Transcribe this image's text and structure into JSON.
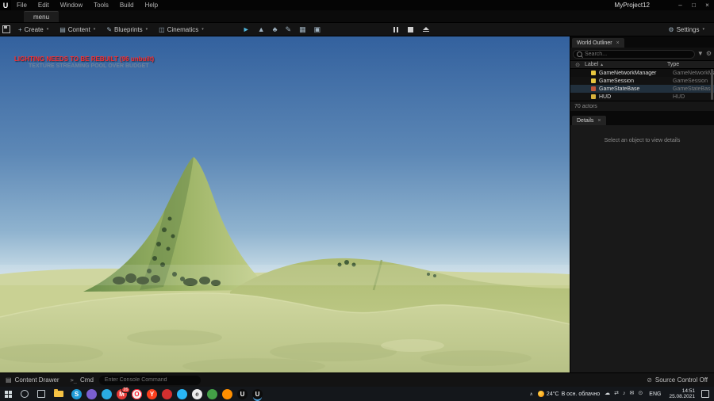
{
  "window": {
    "logo_glyph": "U",
    "menus": [
      "File",
      "Edit",
      "Window",
      "Tools",
      "Build",
      "Help"
    ],
    "project": "MyProject12",
    "controls": {
      "min": "–",
      "max": "□",
      "close": "×"
    }
  },
  "tabs": {
    "level_tab": "menu"
  },
  "toolbar": {
    "buttons": [
      {
        "label": "Create",
        "glyph": "+"
      },
      {
        "label": "Content",
        "glyph": "▤"
      },
      {
        "label": "Blueprints",
        "glyph": "✎"
      },
      {
        "label": "Cinematics",
        "glyph": "◫"
      }
    ],
    "modes": [
      {
        "name": "select-mode-icon",
        "glyph": "►",
        "color": "#4fb3d9"
      },
      {
        "name": "landscape-mode-icon",
        "glyph": "▲",
        "color": "#9fb2c0"
      },
      {
        "name": "foliage-mode-icon",
        "glyph": "♣",
        "color": "#9fb2c0"
      },
      {
        "name": "paint-mode-icon",
        "glyph": "✎",
        "color": "#9fb2c0"
      },
      {
        "name": "fracture-mode-icon",
        "glyph": "▦",
        "color": "#9fb2c0"
      },
      {
        "name": "brush-mode-icon",
        "glyph": "▣",
        "color": "#9fb2c0"
      }
    ],
    "settings_label": "Settings"
  },
  "viewport": {
    "warning_line1": "LIGHTING NEEDS TO BE REBUILT (96 unbuilt)",
    "warning_line2": "TEXTURE STREAMING POOL OVER BUDGET"
  },
  "outliner": {
    "title": "World Outliner",
    "search_placeholder": "Search...",
    "col_label": "Label",
    "col_type": "Type",
    "sort_arrow": "▲",
    "rows": [
      {
        "label": "GameNetworkManager",
        "type": "GameNetworkManager",
        "icon_color": "#e7c63f"
      },
      {
        "label": "GameSession",
        "type": "GameSession",
        "icon_color": "#e7c63f"
      },
      {
        "label": "GameStateBase",
        "type": "GameStateBase",
        "icon_color": "#c0543a"
      },
      {
        "label": "HUD",
        "type": "HUD",
        "icon_color": "#d8b13c"
      }
    ],
    "footer": "70 actors"
  },
  "details": {
    "title": "Details",
    "empty_text": "Select an object to view details"
  },
  "statusbar": {
    "content_drawer": "Content Drawer",
    "cmd": "Cmd",
    "console_placeholder": "Enter Console Command",
    "source_control": "Source Control Off"
  },
  "taskbar": {
    "apps": [
      {
        "name": "taskbar-app-blue-messenger",
        "bg": "#1f9bd7",
        "glyph": "S"
      },
      {
        "name": "taskbar-app-purple",
        "bg": "#7a5fd0",
        "glyph": ""
      },
      {
        "name": "taskbar-app-blue",
        "bg": "#2aabe2",
        "glyph": ""
      },
      {
        "name": "taskbar-app-mail",
        "bg": "#e53935",
        "glyph": "M",
        "badge": "26"
      },
      {
        "name": "taskbar-app-opera",
        "bg": "#f2f2f2",
        "fg": "#ff1b2d",
        "glyph": "O",
        "ring": "#ff1b2d"
      },
      {
        "name": "taskbar-app-yandex",
        "bg": "#fc3f1d",
        "glyph": "Y"
      },
      {
        "name": "taskbar-app-red",
        "bg": "#d32f2f",
        "glyph": ""
      },
      {
        "name": "taskbar-app-lightblue",
        "bg": "#29b6f6",
        "glyph": ""
      },
      {
        "name": "taskbar-app-white",
        "bg": "#ececec",
        "fg": "#444",
        "glyph": "e"
      },
      {
        "name": "taskbar-app-green",
        "bg": "#43a047",
        "glyph": ""
      },
      {
        "name": "taskbar-app-orange",
        "bg": "#ff8f00",
        "glyph": ""
      },
      {
        "name": "taskbar-app-unreal-1",
        "bg": "#0c0c0c",
        "glyph": "U"
      },
      {
        "name": "taskbar-app-unreal-2",
        "bg": "#0c0c0c",
        "glyph": "U",
        "active": true
      }
    ],
    "tray_icons": [
      {
        "name": "onedrive-cloud-icon",
        "glyph": "☁"
      },
      {
        "name": "sync-icon",
        "glyph": "⇄"
      },
      {
        "name": "volume-icon",
        "glyph": "♪"
      },
      {
        "name": "mail-tray-icon",
        "glyph": "✉"
      },
      {
        "name": "network-icon",
        "glyph": "⊙"
      }
    ],
    "hidden_icons_chevron": "∧",
    "weather_temp": "24°C",
    "weather_text": "В осн. облачно",
    "lang": "ENG",
    "time": "14:51",
    "date": "25.08.2021"
  },
  "icons": {
    "close": "×",
    "eye": "⊙",
    "gear": "⚙",
    "caret": "▾",
    "filter": "▼",
    "source_control_off": "⊘",
    "drawer": "▤",
    "cmd_prompt": ">_"
  }
}
